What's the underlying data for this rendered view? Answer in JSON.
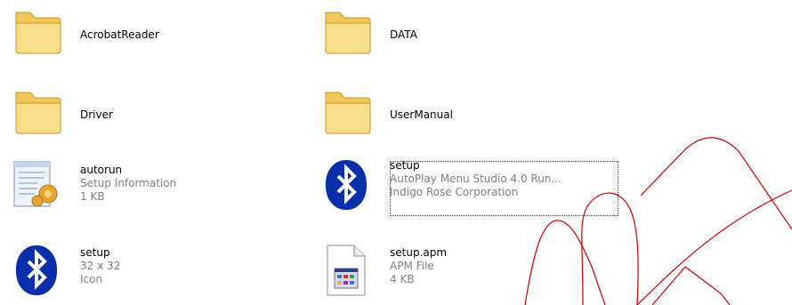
{
  "items": [
    {
      "name": "AcrobatReader",
      "kind": "folder"
    },
    {
      "name": "DATA",
      "kind": "folder"
    },
    {
      "name": "Driver",
      "kind": "folder"
    },
    {
      "name": "UserManual",
      "kind": "folder"
    },
    {
      "name": "autorun",
      "line2": "Setup Information",
      "line3": "1 KB",
      "kind": "inf"
    },
    {
      "name": "setup",
      "line2": "AutoPlay Menu Studio 4.0 Run...",
      "line3": "Indigo Rose Corporation",
      "kind": "bluetooth-exe",
      "selected": true
    },
    {
      "name": "setup",
      "line2": "32 x 32",
      "line3": "Icon",
      "kind": "bluetooth-icon"
    },
    {
      "name": "setup.apm",
      "line2": "APM File",
      "line3": "4 KB",
      "kind": "apm"
    }
  ],
  "colors": {
    "folder": "#f5d76e",
    "folder_dark": "#d9a92e",
    "bluetooth": "#0a2fa8",
    "secondary_text": "#7f7f7f",
    "watermark": "#cc0000"
  }
}
